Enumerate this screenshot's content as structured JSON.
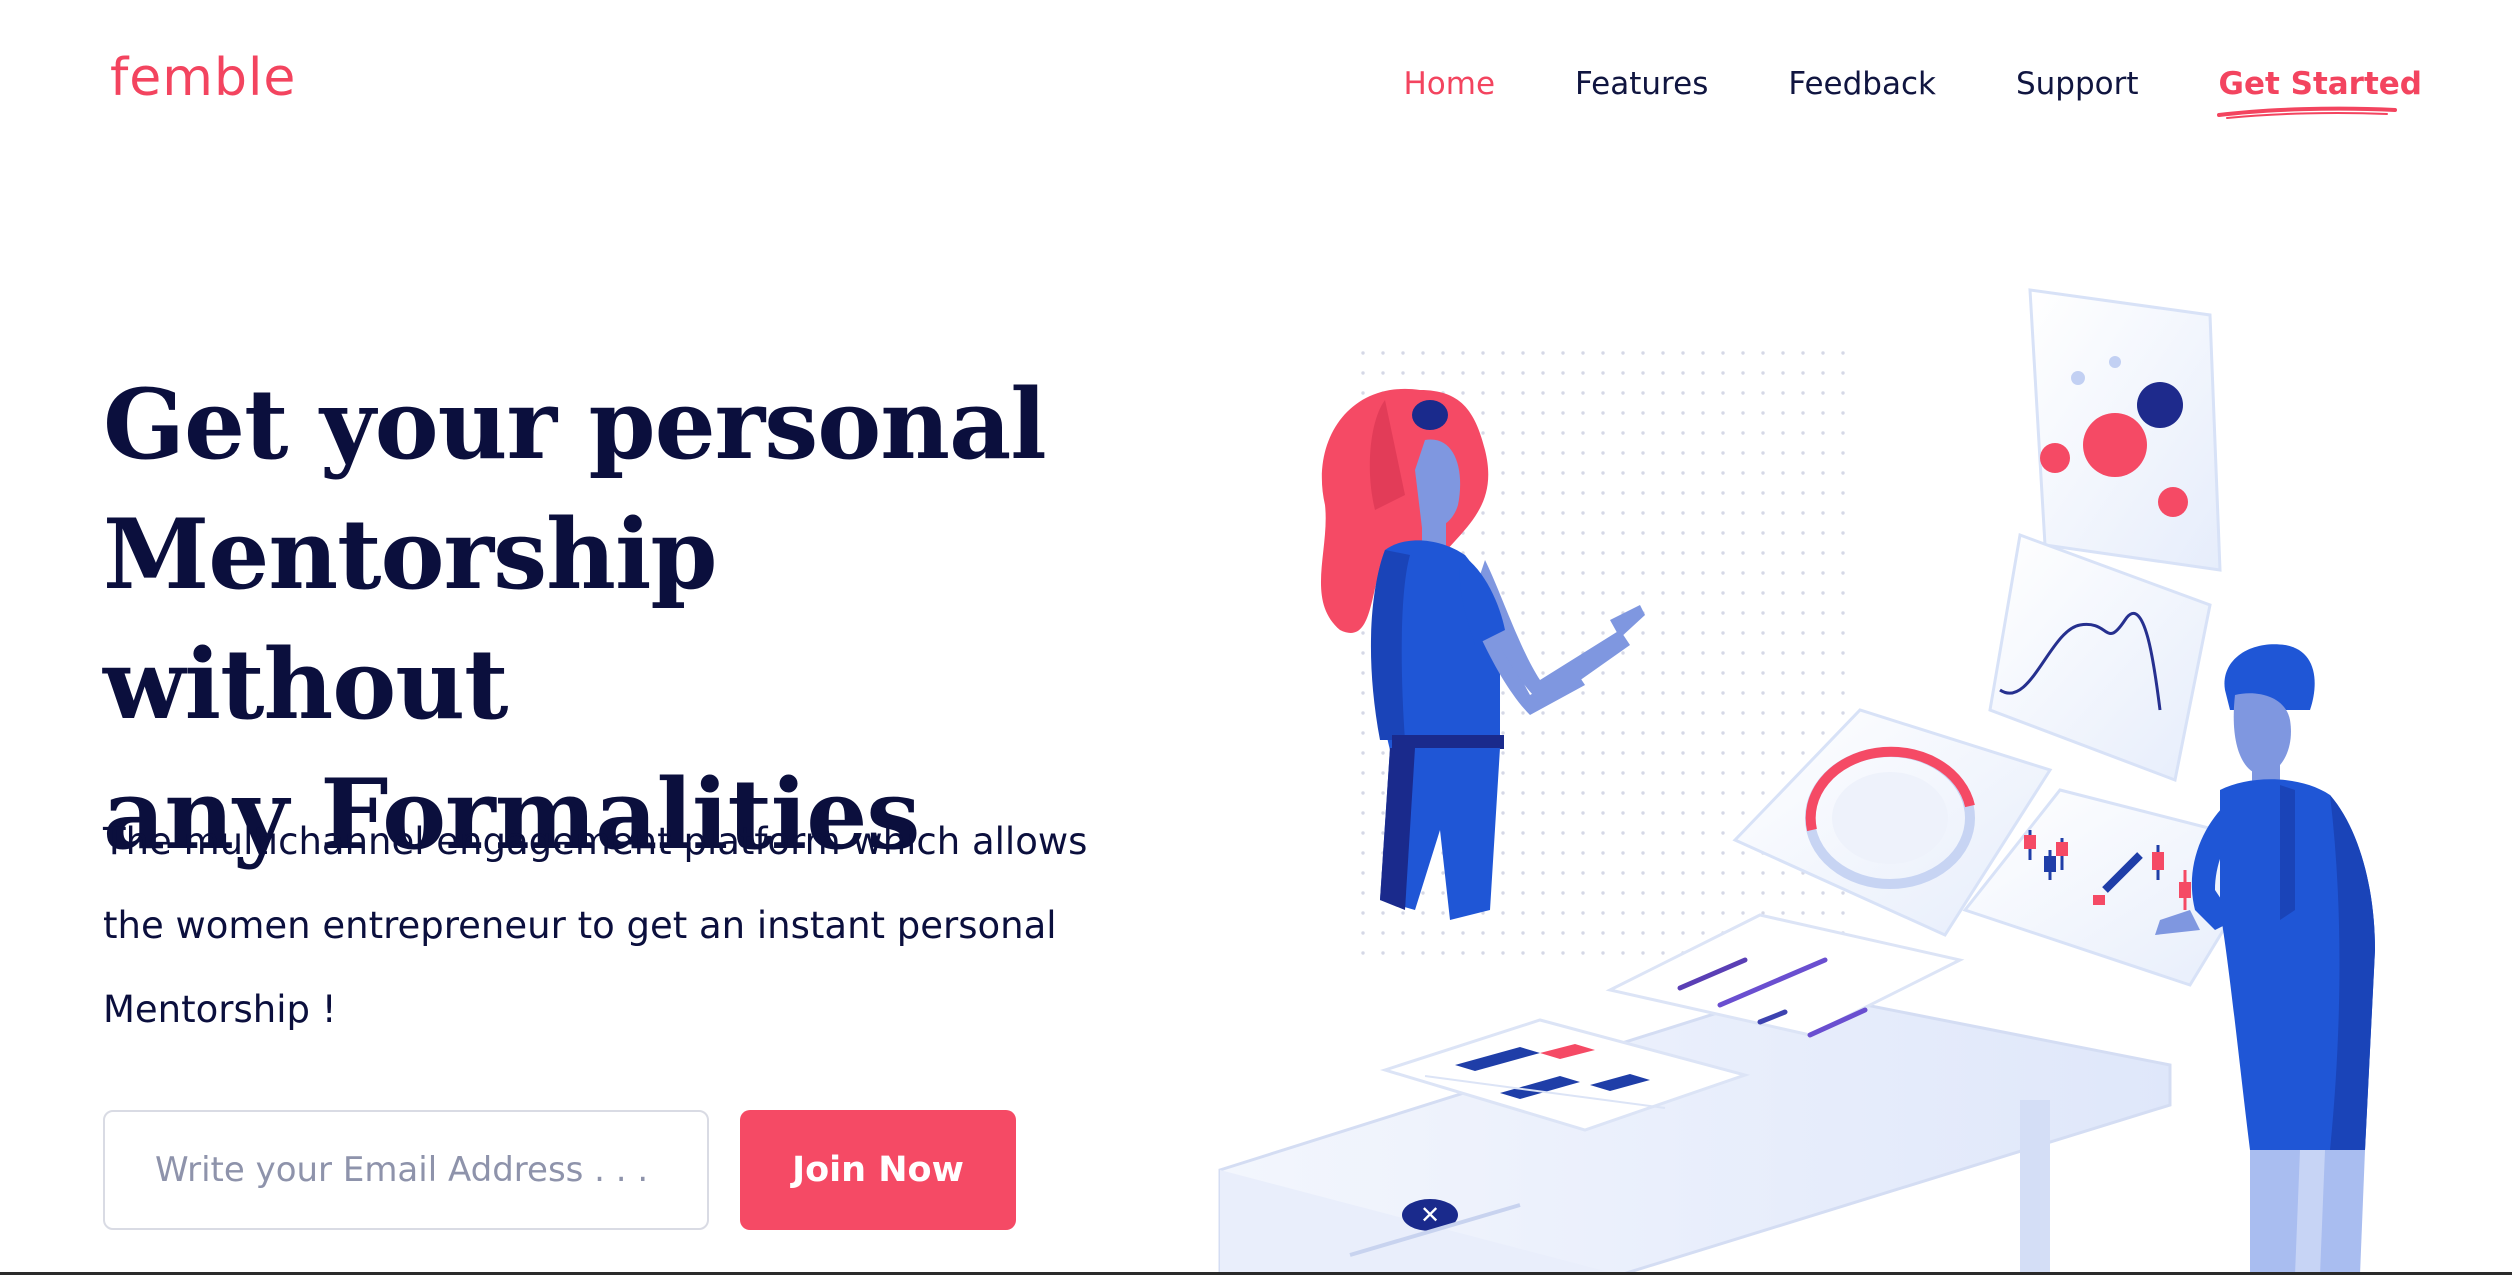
{
  "brand": {
    "logo_text": "femble",
    "accent_color": "#f3445f",
    "text_color": "#0b0f3d",
    "illustration_blue": "#1f56d6",
    "illustration_navy": "#1a2a8c"
  },
  "nav": {
    "items": [
      {
        "label": "Home",
        "active": true
      },
      {
        "label": "Features",
        "active": false
      },
      {
        "label": "Feedback",
        "active": false
      },
      {
        "label": "Support",
        "active": false
      }
    ],
    "cta_label": "Get Started"
  },
  "hero": {
    "title_lines": [
      "Get your personal",
      "Mentorship without",
      "any Formalities"
    ],
    "description_lines": [
      "The multichannel engagement platform which allows",
      "the women entrepreneur to get an instant personal",
      "Mentorship !"
    ]
  },
  "signup": {
    "email_placeholder": "Write your Email Address . . .",
    "email_value": "",
    "join_label": "Join Now"
  },
  "illustration": {
    "subject": "two-people-analytics-dashboard",
    "icons": [
      "dot-grid-pattern",
      "bubble-chart-card",
      "line-chart-card",
      "donut-chart-card",
      "candlestick-chart-card",
      "text-lines-card",
      "data-table-card",
      "close-icon"
    ]
  }
}
